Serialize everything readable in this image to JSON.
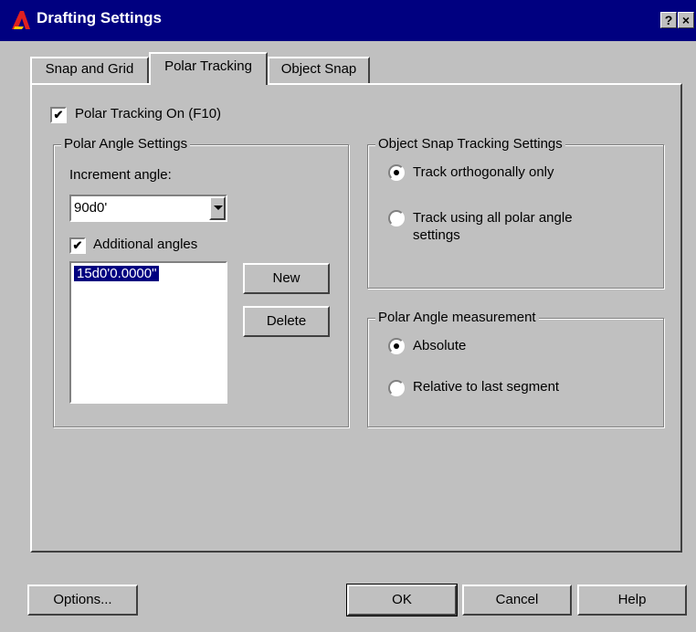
{
  "window": {
    "title": "Drafting Settings",
    "help_button": "?",
    "close_button": "×"
  },
  "tabs": [
    {
      "label": "Snap and Grid",
      "active": false
    },
    {
      "label": "Polar Tracking",
      "active": true
    },
    {
      "label": "Object Snap",
      "active": false
    }
  ],
  "polar_tracking_on": {
    "label": "Polar Tracking On (F10)",
    "checked": true
  },
  "polar_angle_settings": {
    "title": "Polar Angle Settings",
    "increment_label": "Increment angle:",
    "increment_value": "90d0'",
    "additional_angles": {
      "label": "Additional angles",
      "checked": true
    },
    "angles_list": [
      "15d0'0.0000\""
    ],
    "new_button": "New",
    "delete_button": "Delete"
  },
  "object_snap_tracking": {
    "title": "Object Snap Tracking Settings",
    "options": [
      {
        "label": "Track orthogonally only",
        "selected": true
      },
      {
        "label": "Track using all polar angle settings",
        "selected": false
      }
    ]
  },
  "polar_angle_measurement": {
    "title": "Polar Angle measurement",
    "options": [
      {
        "label": "Absolute",
        "selected": true
      },
      {
        "label": "Relative to last segment",
        "selected": false
      }
    ]
  },
  "footer": {
    "options_button": "Options...",
    "ok_button": "OK",
    "cancel_button": "Cancel",
    "help_button": "Help"
  },
  "colors": {
    "titlebar": "#000080",
    "face": "#c0c0c0",
    "selection": "#000080"
  }
}
